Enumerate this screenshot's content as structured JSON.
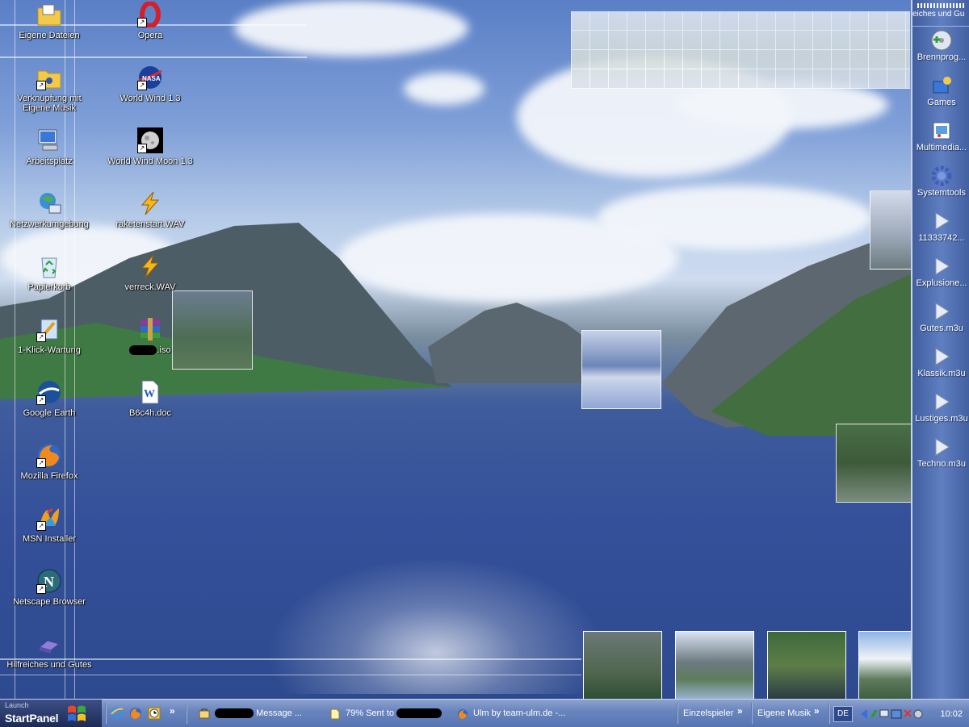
{
  "desktop": {
    "icons_left": [
      {
        "label": "Eigene Dateien",
        "icon": "folder-documents-icon",
        "shortcut": false
      },
      {
        "label": "Verknüpfung mit Eigene Musik",
        "icon": "folder-music-icon",
        "shortcut": true
      },
      {
        "label": "Arbeitsplatz",
        "icon": "computer-icon",
        "shortcut": false
      },
      {
        "label": "Netzwerkumgebung",
        "icon": "network-icon",
        "shortcut": false
      },
      {
        "label": "Papierkorb",
        "icon": "recycle-bin-icon",
        "shortcut": false
      },
      {
        "label": "1-Klick-Wartung",
        "icon": "maintenance-icon",
        "shortcut": true
      },
      {
        "label": "Google Earth",
        "icon": "google-earth-icon",
        "shortcut": true
      },
      {
        "label": "Mozilla Firefox",
        "icon": "firefox-icon",
        "shortcut": true
      },
      {
        "label": "MSN Installer",
        "icon": "msn-icon",
        "shortcut": true
      },
      {
        "label": "Netscape Browser",
        "icon": "netscape-icon",
        "shortcut": true
      },
      {
        "label": "Hilfreiches und Gutes",
        "icon": "folder-icon",
        "shortcut": false
      }
    ],
    "icons_right": [
      {
        "label": "Opera",
        "icon": "opera-icon",
        "shortcut": true
      },
      {
        "label": "World Wind 1.3",
        "icon": "nasa-icon",
        "shortcut": true
      },
      {
        "label": "World Wind Moon 1.3",
        "icon": "moon-icon",
        "shortcut": true
      },
      {
        "label": "raketenstart.WAV",
        "icon": "winamp-audio-icon",
        "shortcut": false
      },
      {
        "label": "verreck.WAV",
        "icon": "winamp-audio-icon",
        "shortcut": false
      },
      {
        "label": ".iso",
        "icon": "winrar-archive-icon",
        "shortcut": false
      },
      {
        "label": "B6c4h.doc",
        "icon": "word-document-icon",
        "shortcut": false
      }
    ]
  },
  "side_panel": {
    "title": "eiches und Gu",
    "items": [
      {
        "label": "Brennprog...",
        "icon": "burn-cd-icon"
      },
      {
        "label": "Games",
        "icon": "games-icon"
      },
      {
        "label": "Multimedia...",
        "icon": "multimedia-icon"
      },
      {
        "label": "Systemtools",
        "icon": "gear-icon"
      },
      {
        "label": "11333742...",
        "icon": "play-icon"
      },
      {
        "label": "Explusione...",
        "icon": "play-icon"
      },
      {
        "label": "Gutes.m3u",
        "icon": "play-icon"
      },
      {
        "label": "Klassik.m3u",
        "icon": "play-icon"
      },
      {
        "label": "Lustiges.m3u",
        "icon": "play-icon"
      },
      {
        "label": "Techno.m3u",
        "icon": "play-icon"
      }
    ]
  },
  "taskbar": {
    "start_launch": "Launch",
    "start_label": "StartPanel",
    "quicklaunch": [
      "ie-icon",
      "firefox-icon",
      "clock-icon"
    ],
    "chevron": "»",
    "tasks": [
      {
        "label": "Message ...",
        "icon": "message-icon"
      },
      {
        "label": "79% Sent to",
        "icon": "file-icon"
      },
      {
        "label": "Ulm by team-ulm.de -...",
        "icon": "firefox-icon"
      }
    ],
    "toolbars": [
      "Einzelspieler",
      "Eigene Musik"
    ],
    "language": "DE",
    "clock": "10:02"
  },
  "colors": {
    "taskbar": "#6a86bf",
    "panel": "#4f6fb2",
    "start": "#1d2a55"
  }
}
